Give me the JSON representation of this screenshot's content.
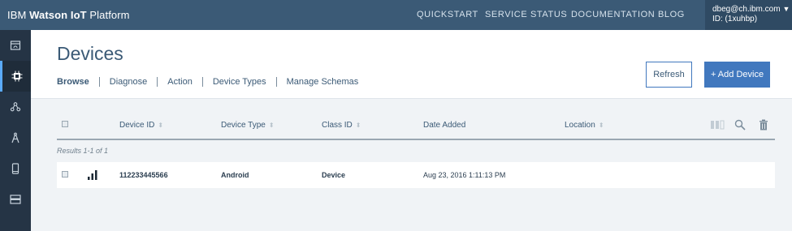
{
  "app": {
    "brand_prefix": "IBM ",
    "brand_bold": "Watson IoT",
    "brand_suffix": " Platform",
    "nav": [
      "QUICKSTART",
      "SERVICE STATUS",
      "DOCUMENTATION",
      "BLOG"
    ],
    "user_email": "dbeg@ch.ibm.com",
    "user_id": "ID: (1xuhbp)",
    "caret": "▼"
  },
  "sidebar": {
    "items": [
      {
        "icon": "dashboard-icon"
      },
      {
        "icon": "chip-icon",
        "active": true
      },
      {
        "icon": "members-icon"
      },
      {
        "icon": "compass-icon"
      },
      {
        "icon": "mobile-icon"
      },
      {
        "icon": "usage-icon"
      }
    ]
  },
  "page": {
    "title": "Devices",
    "tabs": [
      "Browse",
      "Diagnose",
      "Action",
      "Device Types",
      "Manage Schemas"
    ],
    "refresh_label": "Refresh",
    "add_label": "+ Add Device"
  },
  "table": {
    "columns": [
      "Device ID",
      "Device Type",
      "Class ID",
      "Date Added",
      "Location"
    ],
    "sort_glyph": "⬍",
    "results_text": "Results 1-1 of 1",
    "rows": [
      {
        "device_id": "112233445566",
        "device_type": "Android",
        "class_id": "Device",
        "date_added": "Aug 23, 2016 1:11:13 PM",
        "location": ""
      }
    ],
    "tools": [
      "columns-icon",
      "search-icon",
      "trash-icon"
    ]
  },
  "colors": {
    "topbar": "#3b5a76",
    "sidebar": "#253445",
    "accent": "#4178be",
    "active_indicator": "#5aaafa"
  }
}
